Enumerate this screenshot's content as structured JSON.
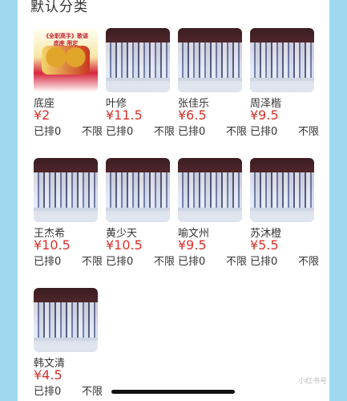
{
  "section_title": "默认分类",
  "items": [
    {
      "name": "底座",
      "price": "¥2",
      "sold": "已排0",
      "limit": "不限",
      "poster_text_1": "《全职高手》歌谣",
      "poster_text_2": "底座 限定"
    },
    {
      "name": "叶修",
      "price": "¥11.5",
      "sold": "已排0",
      "limit": "不限"
    },
    {
      "name": "张佳乐",
      "price": "¥6.5",
      "sold": "已排0",
      "limit": "不限"
    },
    {
      "name": "周泽楷",
      "price": "¥9.5",
      "sold": "已排0",
      "limit": "不限"
    },
    {
      "name": "王杰希",
      "price": "¥10.5",
      "sold": "已排0",
      "limit": "不限"
    },
    {
      "name": "黄少天",
      "price": "¥10.5",
      "sold": "已排0",
      "limit": "不限"
    },
    {
      "name": "喻文州",
      "price": "¥9.5",
      "sold": "已排0",
      "limit": "不限"
    },
    {
      "name": "苏沐橙",
      "price": "¥5.5",
      "sold": "已排0",
      "limit": "不限"
    },
    {
      "name": "韩文清",
      "price": "¥4.5",
      "sold": "已排0",
      "limit": "不限"
    }
  ],
  "watermark": "小红书号"
}
